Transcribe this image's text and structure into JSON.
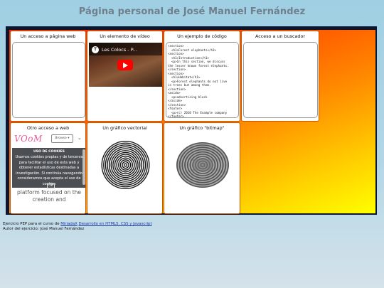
{
  "page": {
    "title": "Página personal de José Manuel Fernández"
  },
  "cells": {
    "web": {
      "title": "Un acceso a página web"
    },
    "video": {
      "title": "Un elemento de vídeo",
      "video_title": "Les Colocs - P...",
      "channel_letter": "T"
    },
    "code": {
      "title": "Un ejemplo de código",
      "code": "<section>\n  <h1>Forest elephants</h1>\n<section>\n  <h1>Introduction</h1>\n  <p>In this section, we discuss\nthe lesser known forest elephants.\n</section>\n<section>\n  <h1>Habitat</h1>\n  <p>Forest elephants do not live\nin trees but among them.\n</section>\n<aside>\n  <p>advertising block\n</aside>\n</section>\n<footer>\n  <p>(c) 2010 The Example company\n</footer>"
    },
    "search": {
      "title": "Acceso a un buscador"
    },
    "other": {
      "title": "Otro acceso a web",
      "logo": "VOoM",
      "browse_label": "Browse ▾",
      "cookie_title": "USO DE COOKIES",
      "cookie_text": "Usamos cookies propias y de terceros para facilitar el uso de esta web y obtener estadísticas destinadas a investigación. Si continúa navegando consideramos que acepta el uso de cookies",
      "ok_label": "OK",
      "body_text": "platform focused on the creation and"
    },
    "vector": {
      "title": "Un gráfico vectorial"
    },
    "bitmap": {
      "title": "Un gráfico \"bitmap\""
    }
  },
  "footer": {
    "line1_prefix": "Ejercicio PEP para el curso de ",
    "link1": "MiriadaX",
    "link2": "Desarrollo en HTML5, CSS y Javascript",
    "line2": "Autor del ejercicio: José Manuel Fernández"
  },
  "colors": {
    "frame": "#0d1630",
    "gradient_start": "#ff2200",
    "gradient_end": "#ffff00",
    "link": "#1a3aa8"
  }
}
